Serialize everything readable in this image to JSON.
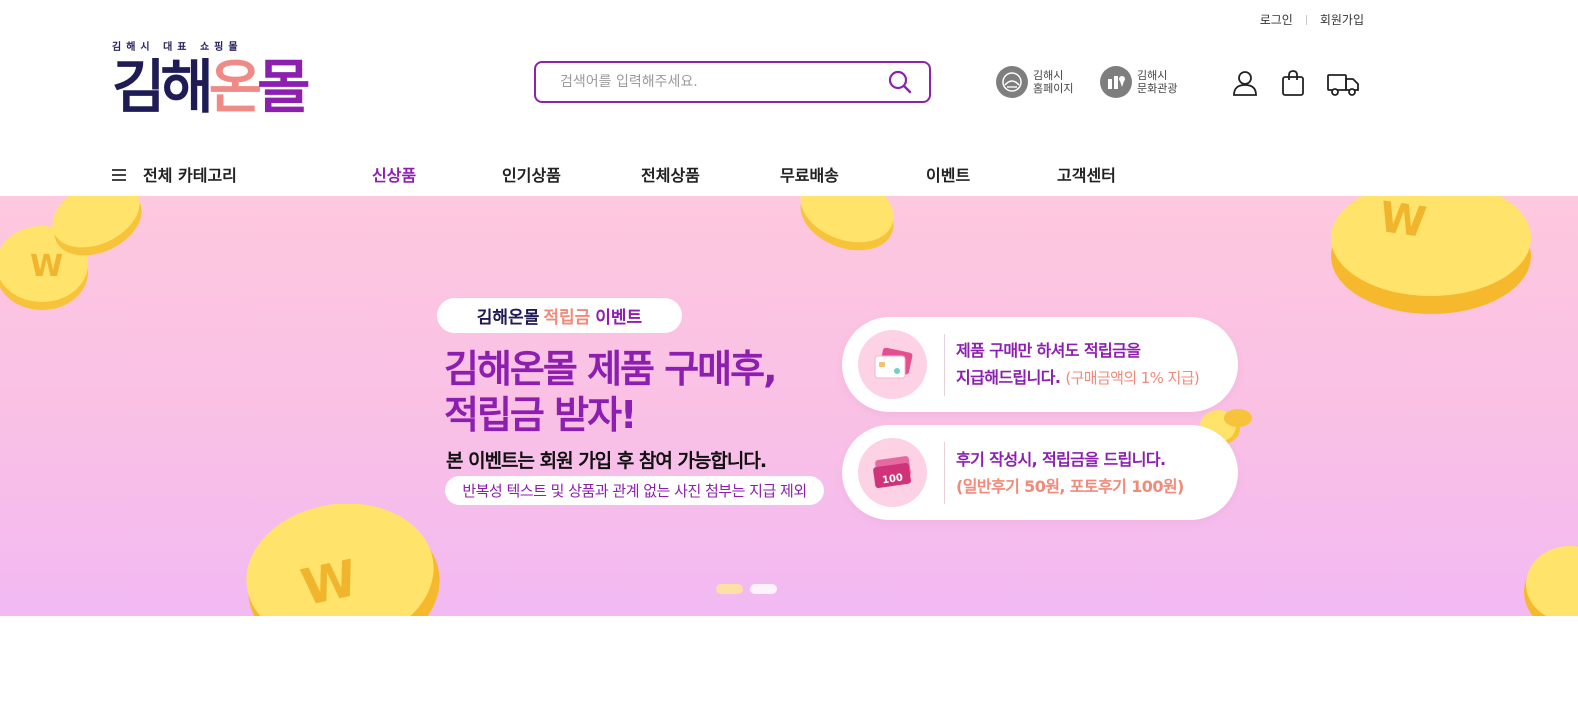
{
  "util": {
    "login": "로그인",
    "signup": "회원가입"
  },
  "logo": {
    "tagline": "김해시 대표 쇼핑몰",
    "part1": "김해",
    "part2": "온",
    "part3": "몰"
  },
  "search": {
    "placeholder": "검색어를 입력해주세요.",
    "value": ""
  },
  "quick": [
    {
      "label": "김해시\n홈페이지",
      "icon": "city-hall-icon"
    },
    {
      "label": "김해시\n문화관광",
      "icon": "map-pin-icon"
    }
  ],
  "icons": [
    "user-icon",
    "shopping-bag-icon",
    "delivery-truck-icon"
  ],
  "nav": {
    "all_category": "전체 카테고리",
    "items": [
      "신상품",
      "인기상품",
      "전체상품",
      "무료배송",
      "이벤트",
      "고객센터"
    ],
    "active_index": 0
  },
  "banner": {
    "tag": {
      "a": "김해온몰",
      "b": "적립금",
      "c": "이벤트"
    },
    "headline_line1": "김해온몰 제품 구매후,",
    "headline_line2": "적립금 받자!",
    "sub1": "본 이벤트는 회원 가입 후 참여 가능합니다.",
    "sub2": "반복성 텍스트 및 상품과 관계 없는 사진 첨부는 지급 제외",
    "card1": {
      "line1": "제품 구매만 하셔도 적립금을",
      "line2": "지급해드립니다.",
      "note": "(구매금액의 1% 지급)",
      "icon": "card-icon"
    },
    "card2": {
      "line1": "후기 작성시, 적립금을 드립니다.",
      "line2": "(일반후기 50원, 포토후기 100원)",
      "icon": "100-bill-icon",
      "bill_text": "100"
    },
    "coin_letter": "W",
    "slides": 2,
    "active_slide": 0
  },
  "colors": {
    "brand_purple": "#8d1fb0",
    "brand_navy": "#1f1b54",
    "coral": "#f08a7a",
    "coin_yellow": "#ffe36a"
  }
}
